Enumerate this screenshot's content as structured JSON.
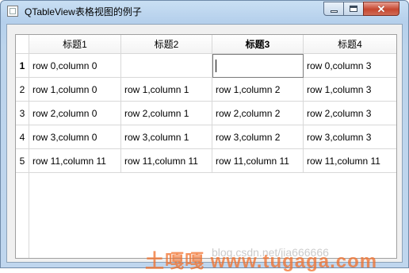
{
  "window": {
    "title": "QTableView表格视图的例子"
  },
  "table": {
    "headers": [
      "标题1",
      "标题2",
      "标题3",
      "标题4"
    ],
    "current_column_index": 2,
    "row_headers": [
      "1",
      "2",
      "3",
      "4",
      "5"
    ],
    "current_row_index": 0,
    "rows": [
      [
        "row 0,column 0",
        "",
        "",
        "row 0,column 3"
      ],
      [
        "row 1,column 0",
        "row 1,column 1",
        "row 1,column 2",
        "row 1,column 3"
      ],
      [
        "row 2,column 0",
        "row 2,column 1",
        "row 2,column 2",
        "row 2,column 3"
      ],
      [
        "row 3,column 0",
        "row 3,column 1",
        "row 3,column 2",
        "row 3,column 3"
      ],
      [
        "row 11,column 11",
        "row 11,column 11",
        "row 11,column 11",
        "row 11,column 11"
      ]
    ],
    "editing_cell": {
      "row": 0,
      "column": 2,
      "value": ""
    }
  },
  "watermark": {
    "text": "土嘎嘎 www.tugaga.com",
    "overlay": "blog.csdn.net/jia666666"
  },
  "colors": {
    "title_bar": "#bcd4ec",
    "close_button": "#c6472f",
    "grid_line": "#d8d8d8",
    "watermark": "#f06e28"
  }
}
